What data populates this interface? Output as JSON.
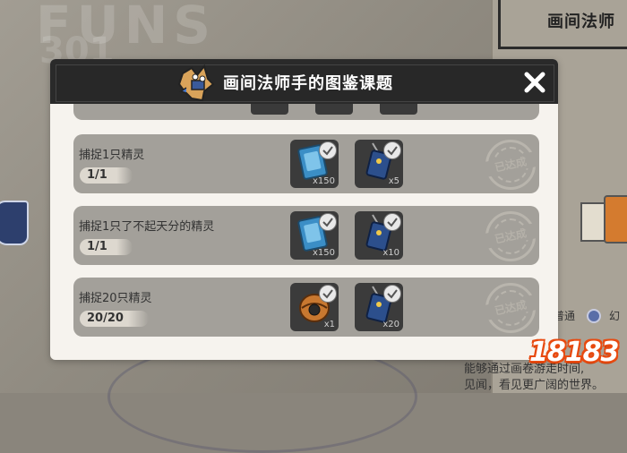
{
  "background": {
    "deco_text": "FUNS",
    "deco_num": "301",
    "right_panel_title": "画间法师",
    "legend_a": "普通",
    "legend_b": "幻",
    "desc_line1": "能够通过画卷游走时间,",
    "desc_line2": "见闻，看见更广阔的世界。"
  },
  "watermark": {
    "text": "18183"
  },
  "modal": {
    "title": "画间法师手的图鉴课题",
    "close_icon": "close-x-icon",
    "tasks": [
      {
        "label": "捕捉1只精灵",
        "progress": "1/1",
        "rewards": [
          {
            "icon": "blue-card-icon",
            "qty": "x150",
            "claimed": true
          },
          {
            "icon": "blue-tag-icon",
            "qty": "x5",
            "claimed": true
          }
        ],
        "status": "已达成"
      },
      {
        "label": "捕捉1只了不起天分的精灵",
        "progress": "1/1",
        "rewards": [
          {
            "icon": "blue-card-icon",
            "qty": "x150",
            "claimed": true
          },
          {
            "icon": "blue-tag-icon",
            "qty": "x10",
            "claimed": true
          }
        ],
        "status": "已达成"
      },
      {
        "label": "捕捉20只精灵",
        "progress": "20/20",
        "rewards": [
          {
            "icon": "orange-ball-icon",
            "qty": "x1",
            "claimed": true
          },
          {
            "icon": "blue-tag-icon",
            "qty": "x20",
            "claimed": true
          }
        ],
        "status": "已达成"
      }
    ]
  },
  "colors": {
    "header_bg": "#2a2a2a",
    "row_bg": "#a3a09a",
    "modal_bg": "#f6f3ee",
    "watermark_orange": "#e84a10"
  }
}
